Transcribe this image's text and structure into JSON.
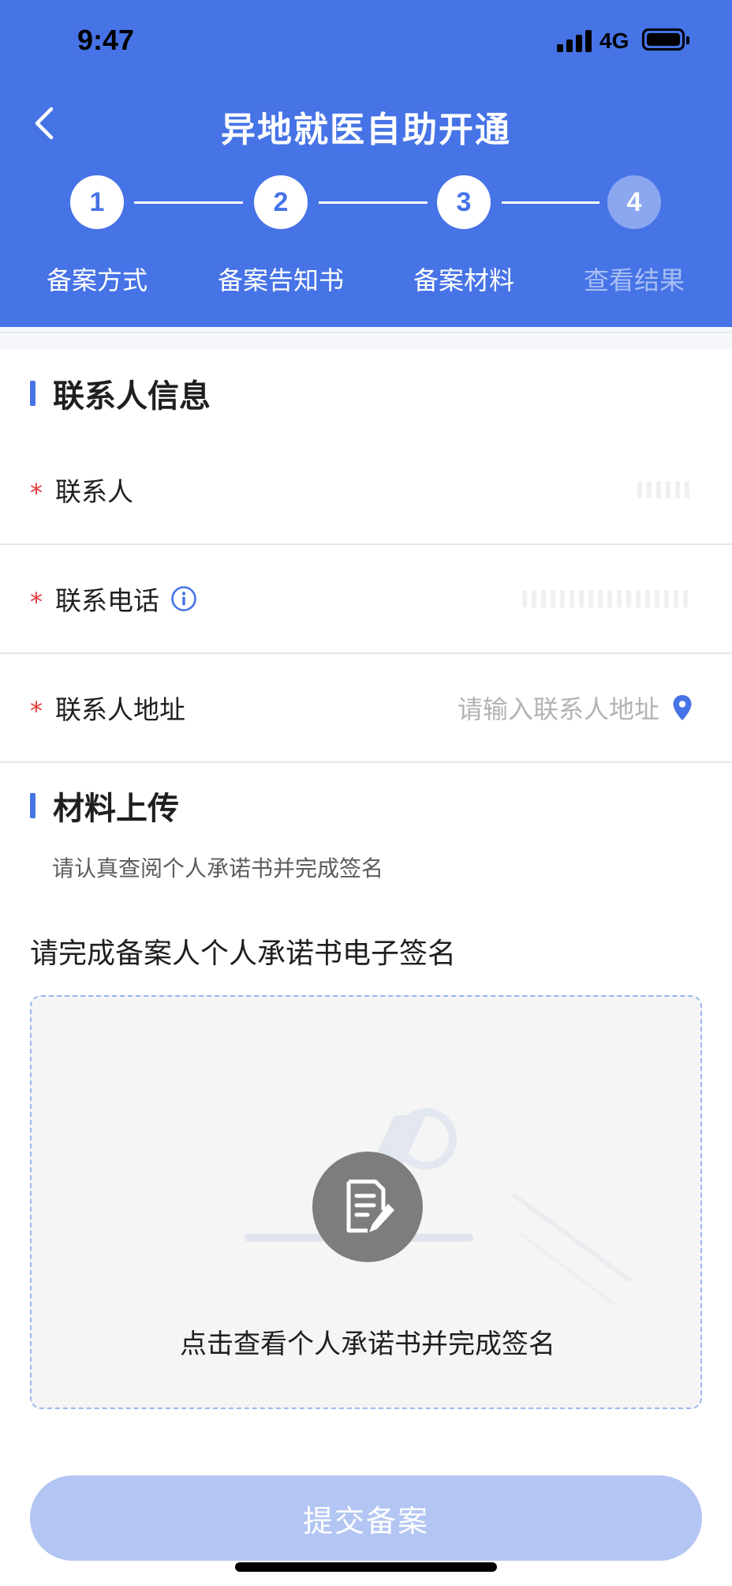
{
  "status_bar": {
    "time": "9:47",
    "network": "4G"
  },
  "header": {
    "title": "异地就医自助开通",
    "back_icon": "chevron-left-icon"
  },
  "stepper": {
    "steps": [
      {
        "number": "1",
        "label": "备案方式",
        "state": "done"
      },
      {
        "number": "2",
        "label": "备案告知书",
        "state": "done"
      },
      {
        "number": "3",
        "label": "备案材料",
        "state": "current"
      },
      {
        "number": "4",
        "label": "查看结果",
        "state": "pending"
      }
    ]
  },
  "contact_section": {
    "title": "联系人信息",
    "fields": [
      {
        "required_mark": "*",
        "label": "联系人",
        "value": ""
      },
      {
        "required_mark": "*",
        "label": "联系电话",
        "value": "",
        "icon": "info-icon"
      },
      {
        "required_mark": "*",
        "label": "联系人地址",
        "placeholder": "请输入联系人地址",
        "icon": "location-pin-icon"
      }
    ]
  },
  "upload_section": {
    "title": "材料上传",
    "helper": "请认真查阅个人承诺书并完成签名",
    "signature_heading": "请完成备案人个人承诺书电子签名",
    "signature_prompt": "点击查看个人承诺书并完成签名",
    "signature_icon": "document-sign-icon"
  },
  "submit": {
    "label": "提交备案"
  },
  "colors": {
    "primary": "#4673e6",
    "required": "#e4393c",
    "disabled_button": "#b3c5f3"
  }
}
